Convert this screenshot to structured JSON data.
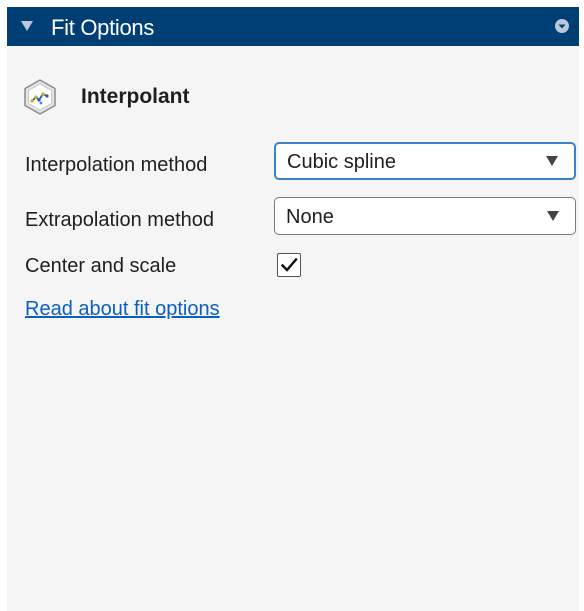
{
  "panel": {
    "title": "Fit Options",
    "accent_color": "#003f74",
    "background_color": "#f5f5f5"
  },
  "fit": {
    "type_label": "Interpolant",
    "icon": "interpolant-fit-icon"
  },
  "interpolation": {
    "label": "Interpolation method",
    "value": "Cubic spline",
    "focused": true
  },
  "extrapolation": {
    "label": "Extrapolation method",
    "value": "None"
  },
  "center_scale": {
    "label": "Center and scale",
    "checked": true
  },
  "help": {
    "link_text": "Read about fit options",
    "link_color": "#0b5fc4"
  }
}
